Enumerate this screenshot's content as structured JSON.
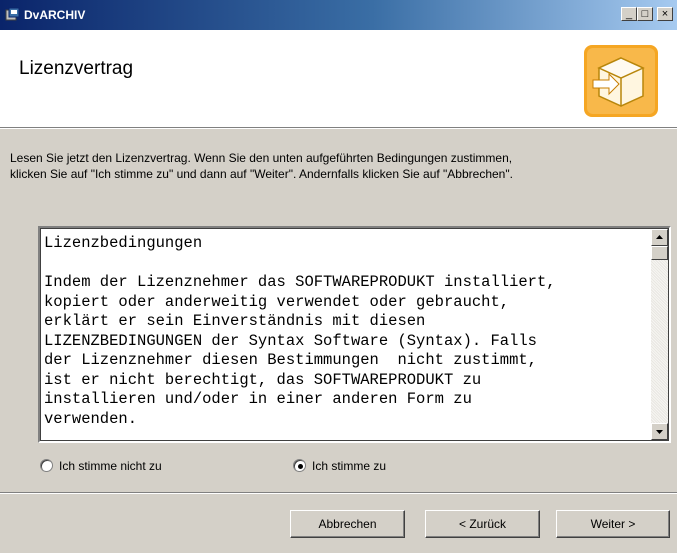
{
  "window": {
    "title": "DvARCHIV",
    "minimize_label": "_",
    "maximize_label": "□",
    "close_label": "×"
  },
  "header": {
    "title": "Lizenzvertrag"
  },
  "intro": {
    "line1": "Lesen Sie jetzt den Lizenzvertrag. Wenn Sie den unten aufgeführten Bedingungen zustimmen,",
    "line2": "klicken Sie auf  \"Ich stimme zu\" und dann auf \"Weiter\". Andernfalls klicken Sie auf \"Abbrechen\"."
  },
  "license": {
    "heading": "Lizenzbedingungen",
    "lines": [
      "Indem der Lizenznehmer das SOFTWAREPRODUKT installiert,",
      "kopiert oder anderweitig verwendet oder gebraucht,",
      "erklärt er sein Einverständnis mit diesen",
      "LIZENZBEDINGUNGEN der Syntax Software (Syntax). Falls",
      "der Lizenznehmer diesen Bestimmungen  nicht zustimmt,",
      "ist er nicht berechtigt, das SOFTWAREPRODUKT zu",
      "installieren und/oder in einer anderen Form zu",
      "verwenden."
    ]
  },
  "options": {
    "disagree_label": "Ich stimme nicht zu",
    "agree_label": "Ich stimme zu",
    "selected": "agree"
  },
  "buttons": {
    "cancel": "Abbrechen",
    "back": "< Zurück",
    "next": "Weiter >"
  },
  "icons": {
    "window": "installer-icon",
    "header": "setup-box-icon",
    "scroll_up": "arrow-up-icon",
    "scroll_down": "arrow-down-icon"
  },
  "colors": {
    "titlebar_start": "#0a246a",
    "titlebar_end": "#a6caf0",
    "face": "#d4d0c8",
    "logo_orange": "#f5a623"
  }
}
